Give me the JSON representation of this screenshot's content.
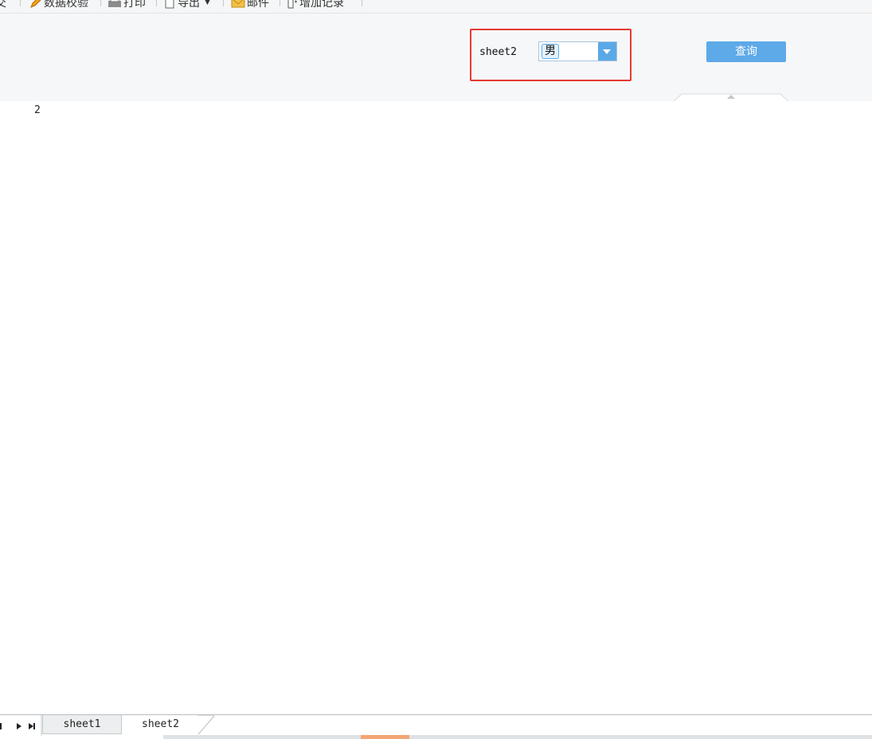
{
  "toolbar": {
    "items": [
      {
        "label": "交",
        "icon": "partial-icon"
      },
      {
        "label": "数据校验",
        "icon": "pencil-icon"
      },
      {
        "label": "打印",
        "icon": "printer-icon"
      },
      {
        "label": "导出",
        "icon": "document-icon"
      },
      {
        "label": "邮件",
        "icon": "envelope-icon"
      },
      {
        "label": "增加记录",
        "icon": "add-record-icon"
      }
    ]
  },
  "params": {
    "label": "sheet2",
    "selected_value": "男",
    "query_label": "查询"
  },
  "report": {
    "cell_value": "2"
  },
  "sheets": {
    "tabs": [
      "sheet1",
      "sheet2"
    ],
    "active": "sheet2"
  },
  "colors": {
    "accent": "#5ea9e8",
    "highlight": "#e53935",
    "scroll_thumb": "#f2a674"
  }
}
